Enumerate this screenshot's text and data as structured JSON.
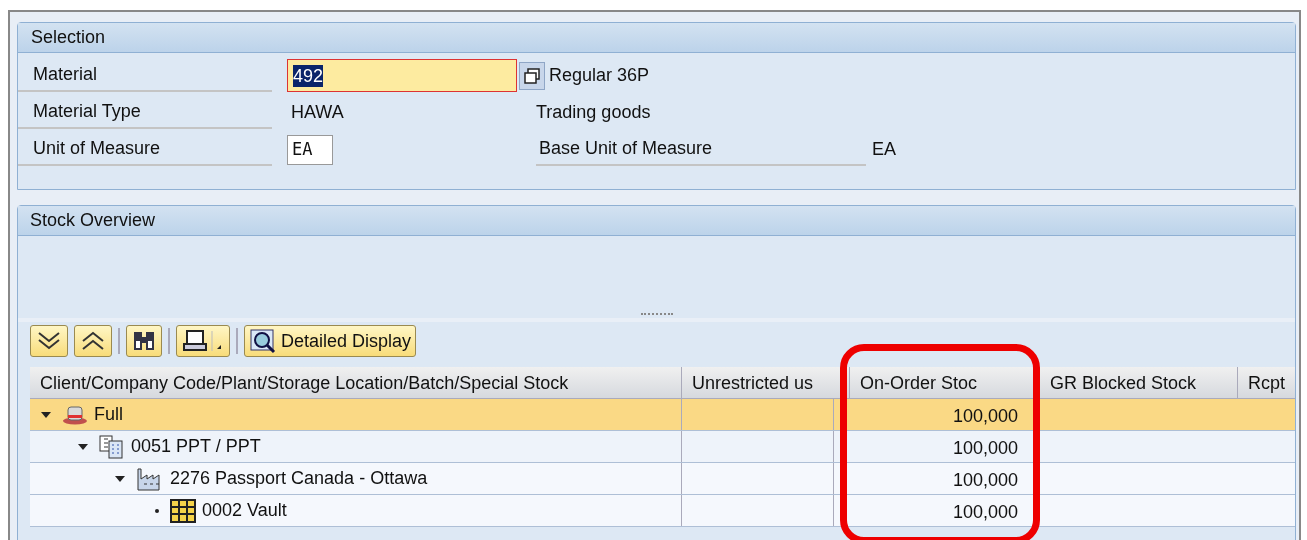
{
  "selection": {
    "title": "Selection",
    "material": {
      "label": "Material",
      "value": "492",
      "description": "Regular 36P"
    },
    "material_type": {
      "label": "Material Type",
      "value": "HAWA",
      "description": "Trading goods"
    },
    "unit_of_measure": {
      "label": "Unit of Measure",
      "value": "EA",
      "base_label": "Base Unit of Measure",
      "base_value": "EA"
    }
  },
  "stock_overview": {
    "title": "Stock Overview",
    "toolbar": {
      "detailed_display": "Detailed Display"
    },
    "table": {
      "columns": [
        "Client/Company Code/Plant/Storage Location/Batch/Special Stock",
        "Unrestricted us",
        "On-Order Stoc",
        "GR Blocked Stock",
        "Rcpt"
      ],
      "rows": [
        {
          "kind": "client",
          "label": "Full",
          "on_order": "100,000",
          "selected": true,
          "expanded": true,
          "children": [
            {
              "kind": "company",
              "label": "0051 PPT / PPT",
              "on_order": "100,000",
              "selected": false,
              "expanded": true,
              "children": [
                {
                  "kind": "plant",
                  "label": "2276 Passport Canada - Ottawa",
                  "on_order": "100,000",
                  "selected": false,
                  "expanded": true,
                  "children": [
                    {
                      "kind": "storage",
                      "label": "0002 Vault",
                      "on_order": "100,000",
                      "selected": false,
                      "expanded": false
                    }
                  ]
                }
              ]
            }
          ]
        }
      ]
    }
  }
}
